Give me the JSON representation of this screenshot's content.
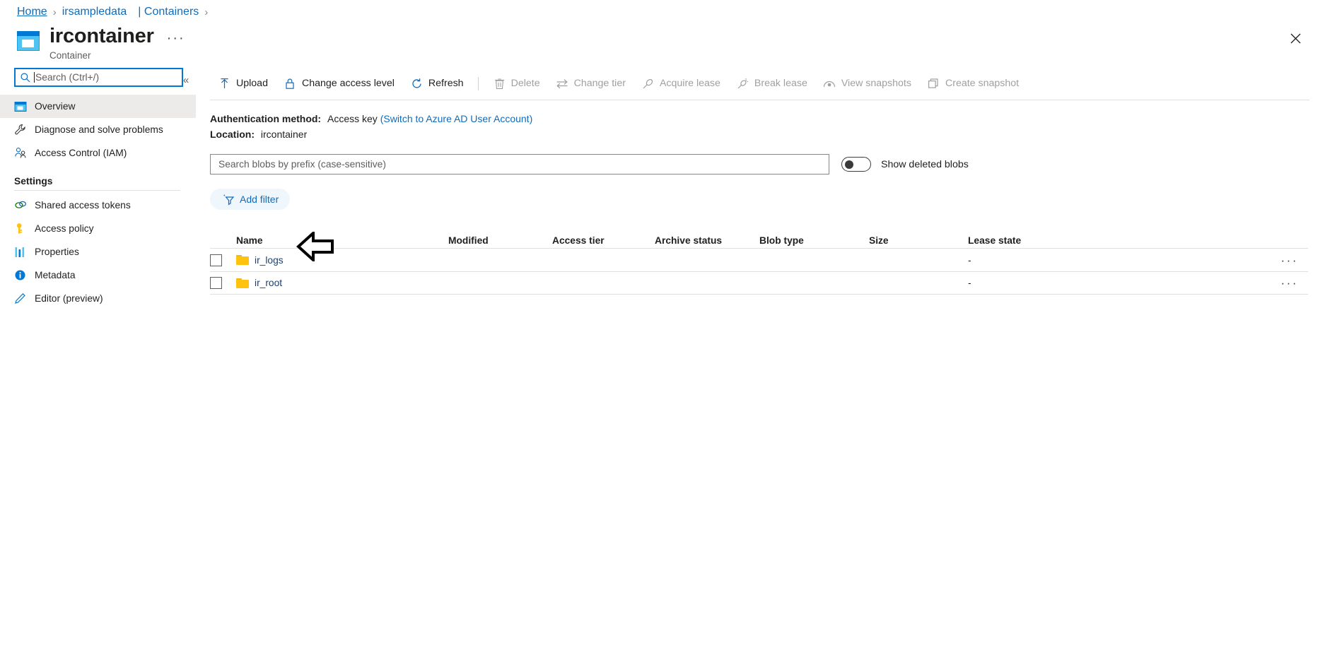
{
  "breadcrumb": {
    "items": [
      {
        "label": "Home",
        "type": "link"
      },
      {
        "label": "irsampledata",
        "type": "link"
      },
      {
        "label": "| Containers",
        "type": "link"
      }
    ],
    "separator": "›"
  },
  "header": {
    "title": "ircontainer",
    "subtitle": "Container",
    "ellipsis_label": "···",
    "icon": "container-icon",
    "close_label": "close-icon"
  },
  "sidebar": {
    "search": {
      "placeholder": "Search (Ctrl+/)",
      "value": ""
    },
    "collapse_label": "«",
    "items": [
      {
        "label": "Overview",
        "icon": "overview-window-icon",
        "selected": true
      },
      {
        "label": "Diagnose and solve problems",
        "icon": "wrench-icon",
        "selected": false
      },
      {
        "label": "Access Control (IAM)",
        "icon": "people-icon",
        "selected": false
      }
    ],
    "group_title": "Settings",
    "settings_items": [
      {
        "label": "Shared access tokens",
        "icon": "link-chain-icon"
      },
      {
        "label": "Access policy",
        "icon": "key-icon"
      },
      {
        "label": "Properties",
        "icon": "bars-icon"
      },
      {
        "label": "Metadata",
        "icon": "info-icon"
      },
      {
        "label": "Editor (preview)",
        "icon": "pencil-icon"
      }
    ]
  },
  "toolbar": {
    "buttons": [
      {
        "label": "Upload",
        "icon": "upload-arrow-icon",
        "disabled": false
      },
      {
        "label": "Change access level",
        "icon": "lock-icon",
        "disabled": false
      },
      {
        "label": "Refresh",
        "icon": "refresh-icon",
        "disabled": false
      },
      {
        "label": "Delete",
        "icon": "trash-icon",
        "disabled": true
      },
      {
        "label": "Change tier",
        "icon": "swap-arrows-icon",
        "disabled": true
      },
      {
        "label": "Acquire lease",
        "icon": "plug-icon",
        "disabled": true
      },
      {
        "label": "Break lease",
        "icon": "plug-broken-icon",
        "disabled": true
      },
      {
        "label": "View snapshots",
        "icon": "camera-icon",
        "disabled": true
      },
      {
        "label": "Create snapshot",
        "icon": "copy-icon",
        "disabled": true
      }
    ]
  },
  "info": {
    "auth_label": "Authentication method:",
    "auth_value": "Access key",
    "auth_link": "(Switch to Azure AD User Account)",
    "location_label": "Location:",
    "location_value": "ircontainer"
  },
  "filters": {
    "blob_search_placeholder": "Search blobs by prefix (case-sensitive)",
    "blob_search_value": "",
    "toggle_label": "Show deleted blobs",
    "toggle_on": false,
    "add_filter_label": "Add filter",
    "add_filter_icon": "add-filter-icon"
  },
  "table": {
    "columns": [
      "Name",
      "Modified",
      "Access tier",
      "Archive status",
      "Blob type",
      "Size",
      "Lease state"
    ],
    "rows": [
      {
        "name": "ir_logs",
        "icon": "folder-icon",
        "modified": "",
        "access_tier": "",
        "archive_status": "",
        "blob_type": "",
        "size": "",
        "lease_state": "-",
        "menu": "···",
        "checked": false
      },
      {
        "name": "ir_root",
        "icon": "folder-icon",
        "modified": "",
        "access_tier": "",
        "archive_status": "",
        "blob_type": "",
        "size": "",
        "lease_state": "-",
        "menu": "···",
        "checked": false
      }
    ]
  },
  "annotation": {
    "arrow": "left-pointing-arrow",
    "target_row": "ir_logs"
  },
  "colors": {
    "accent": "#0078d4",
    "link": "#0f6cbd",
    "selected_nav_bg": "#edebe9",
    "folder": "#ffc20e",
    "disabled_text": "#a19f9d",
    "pill_bg": "#eff6fc"
  }
}
